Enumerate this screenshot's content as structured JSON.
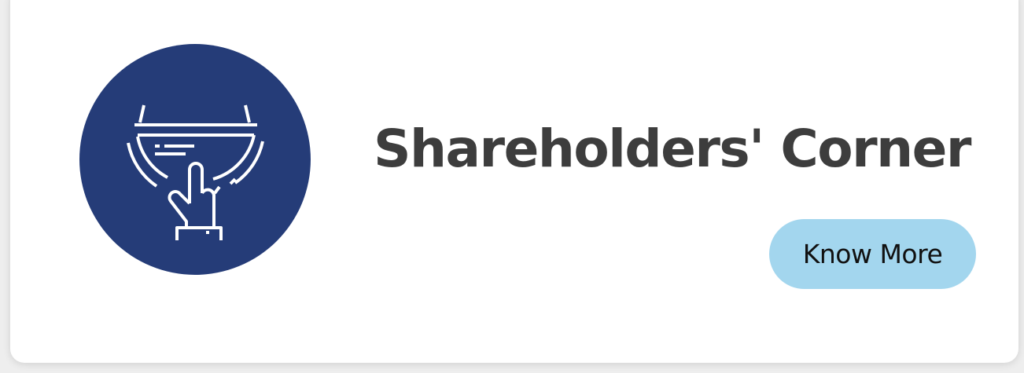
{
  "card": {
    "title": "Shareholders' Corner",
    "cta_label": "Know More"
  },
  "icon": {
    "name": "hand-tapping-screen-icon",
    "circle_color": "#253c78",
    "stroke_color": "#ffffff"
  },
  "colors": {
    "title": "#3d3d3d",
    "button_background": "#a3d6ee",
    "button_text": "#111111",
    "card_background": "#ffffff"
  }
}
